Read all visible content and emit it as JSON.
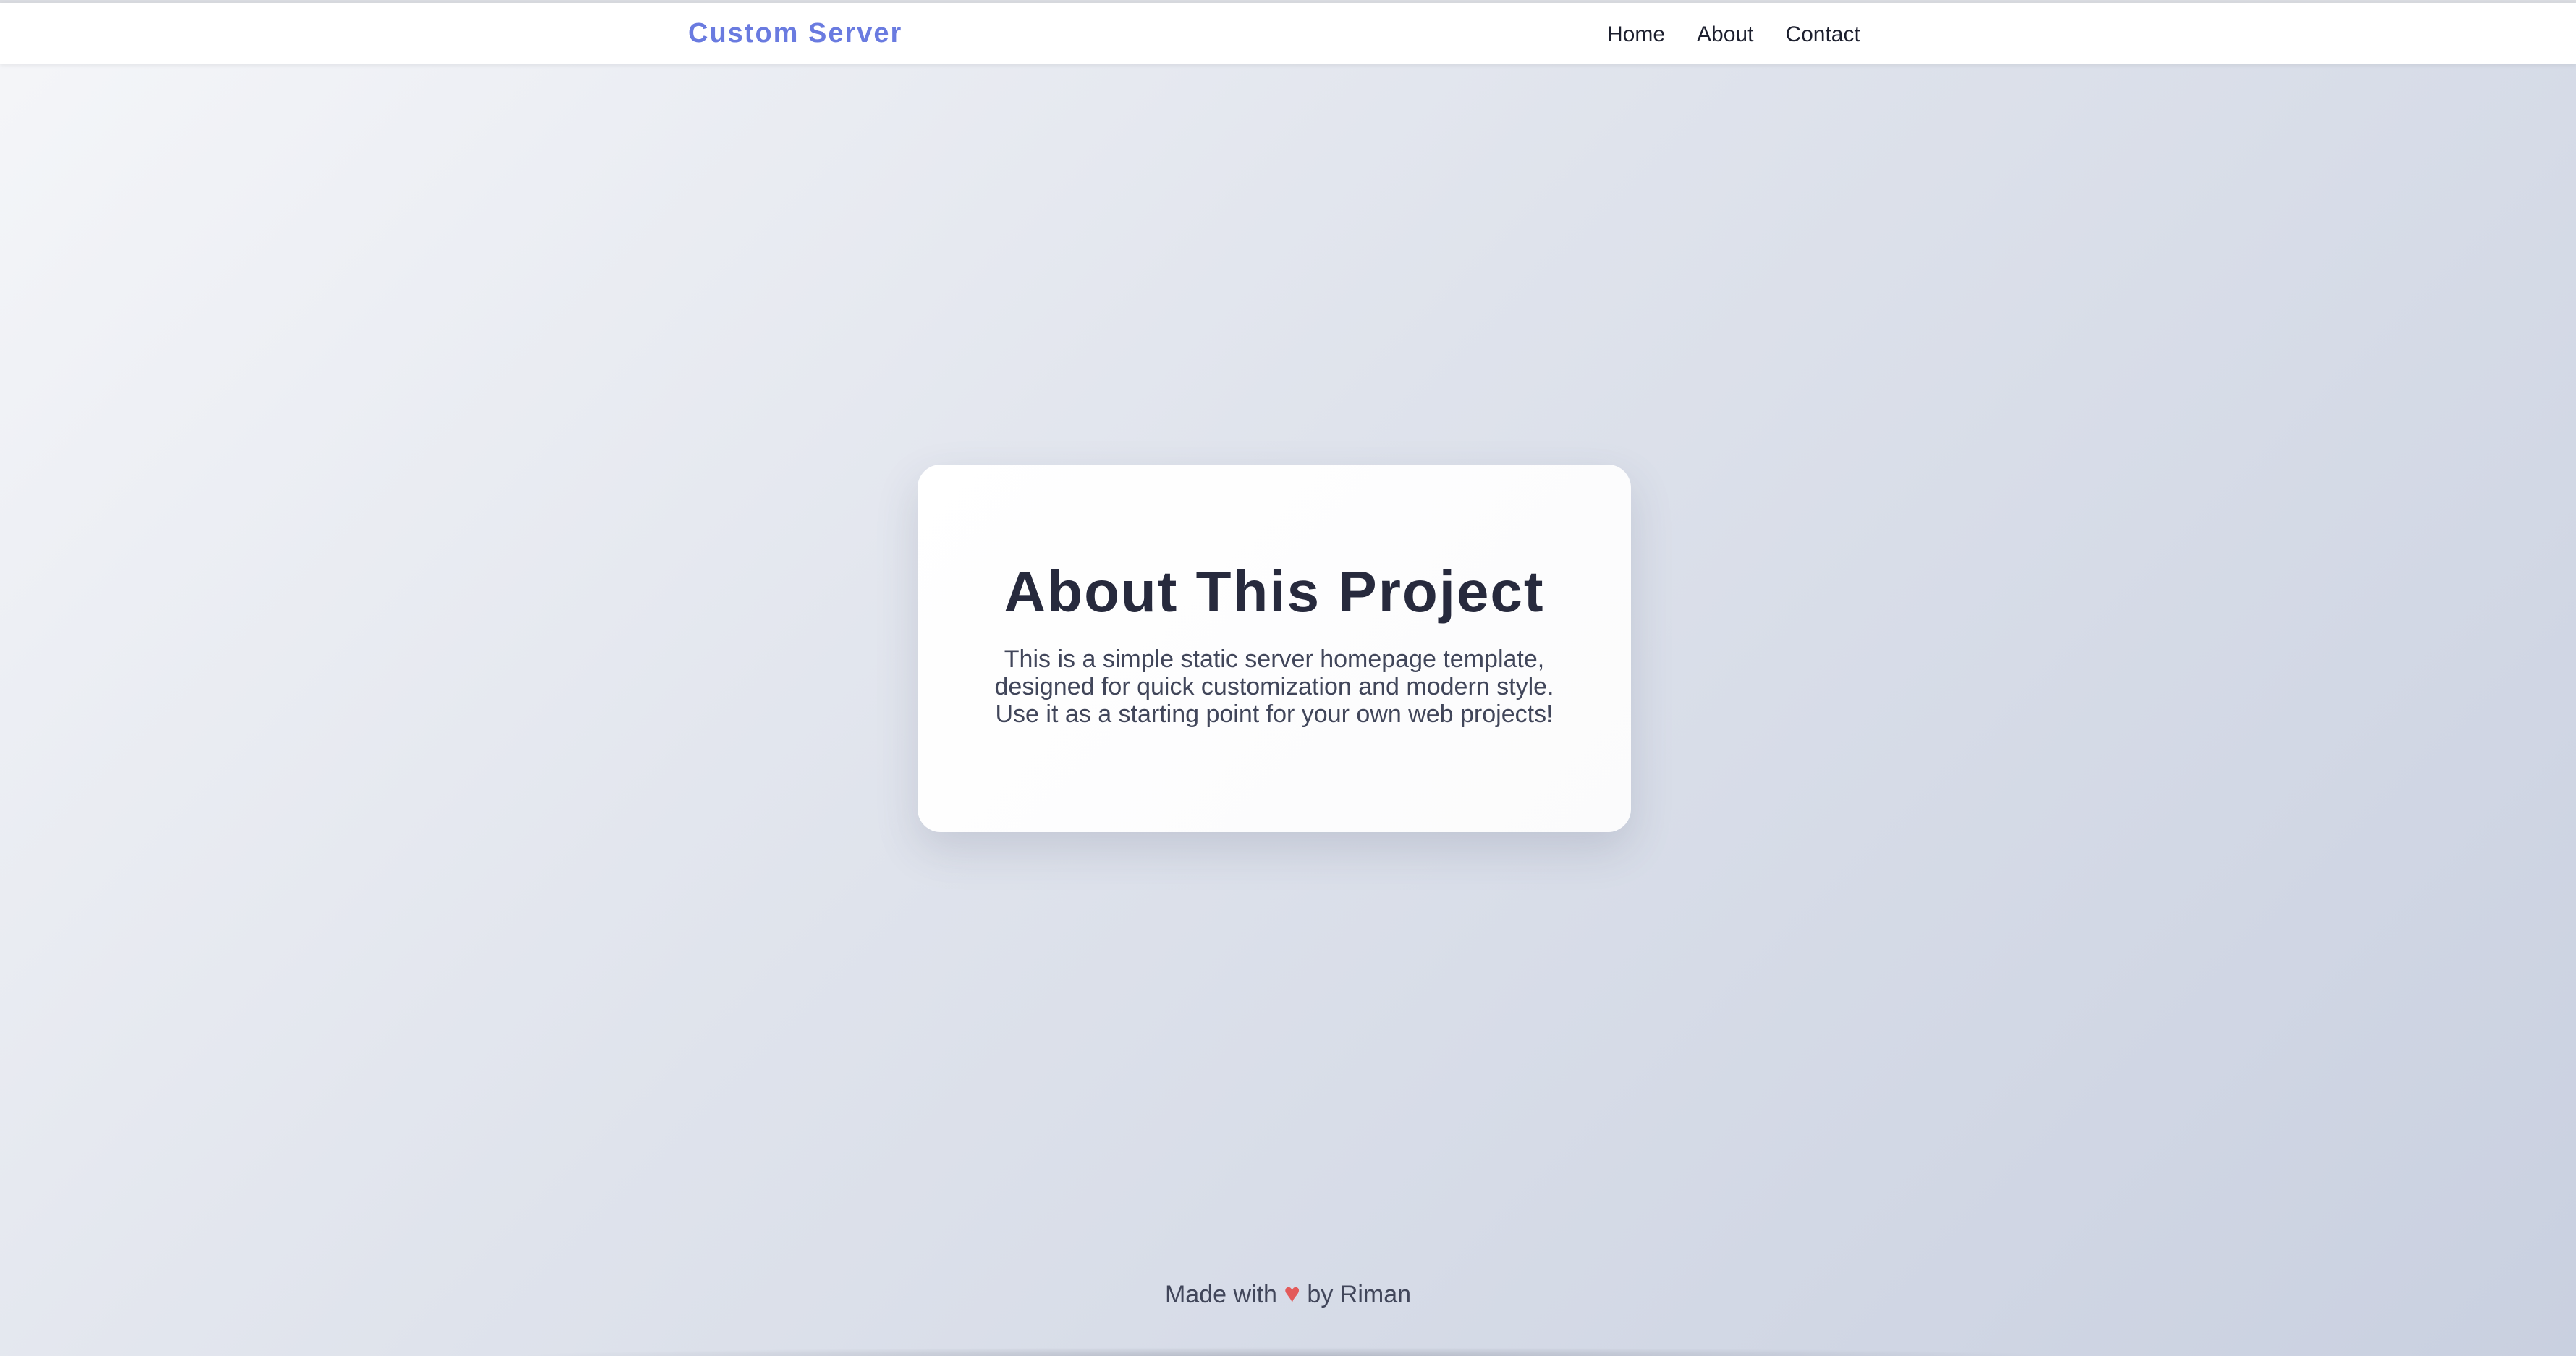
{
  "header": {
    "brand": "Custom Server",
    "nav": [
      {
        "label": "Home"
      },
      {
        "label": "About"
      },
      {
        "label": "Contact"
      }
    ]
  },
  "main": {
    "title": "About This Project",
    "body_lines": [
      "This is a simple static server homepage template,",
      "designed for quick customization and modern style.",
      "Use it as a starting point for your own web projects!"
    ]
  },
  "footer": {
    "prefix": "Made with",
    "heart": "♥",
    "suffix": "by Riman"
  },
  "colors": {
    "brand": "#6a7be0",
    "heart": "#e35a5a",
    "title": "#272a3d",
    "text": "#41465a"
  },
  "icons": {
    "heart": "heart-icon"
  }
}
